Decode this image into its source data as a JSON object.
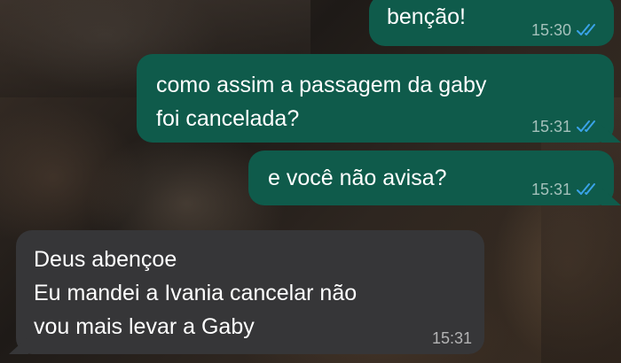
{
  "messages": [
    {
      "direction": "outgoing",
      "text": "benção!",
      "time": "15:30",
      "status": "read"
    },
    {
      "direction": "outgoing",
      "text": "como assim a passagem da gaby\nfoi cancelada?",
      "time": "15:31",
      "status": "read"
    },
    {
      "direction": "outgoing",
      "text": "e você não avisa?",
      "time": "15:31",
      "status": "read"
    },
    {
      "direction": "incoming",
      "text": "Deus abençoe\nEu mandei a Ivania cancelar não\nvou mais levar a Gaby",
      "time": "15:31"
    }
  ],
  "colors": {
    "outgoing_bubble": "#0f5b4b",
    "incoming_bubble": "#363638",
    "read_ticks": "#3aa3e8"
  },
  "icons": {
    "read_receipt": "double-check-icon"
  }
}
